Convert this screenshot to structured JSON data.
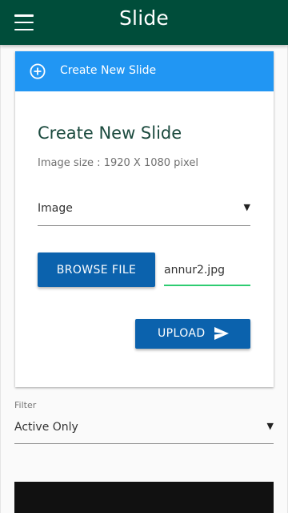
{
  "appbar": {
    "title": "Slide",
    "menu_icon": "menu-icon",
    "color": "#004d3a"
  },
  "card": {
    "header_label": "Create New Slide",
    "header_icon": "add-circle-icon",
    "header_color": "#2196f3",
    "title": "Create New Slide",
    "image_size": "Image size : 1920 X 1080 pixel",
    "type_select": {
      "value": "Image"
    },
    "browse_label": "BROWSE FILE",
    "file_name": "annur2.jpg",
    "upload_label": "UPLOAD",
    "upload_icon": "send-icon",
    "button_color": "#0b62ad"
  },
  "filter": {
    "label": "Filter",
    "value": "Active Only"
  }
}
